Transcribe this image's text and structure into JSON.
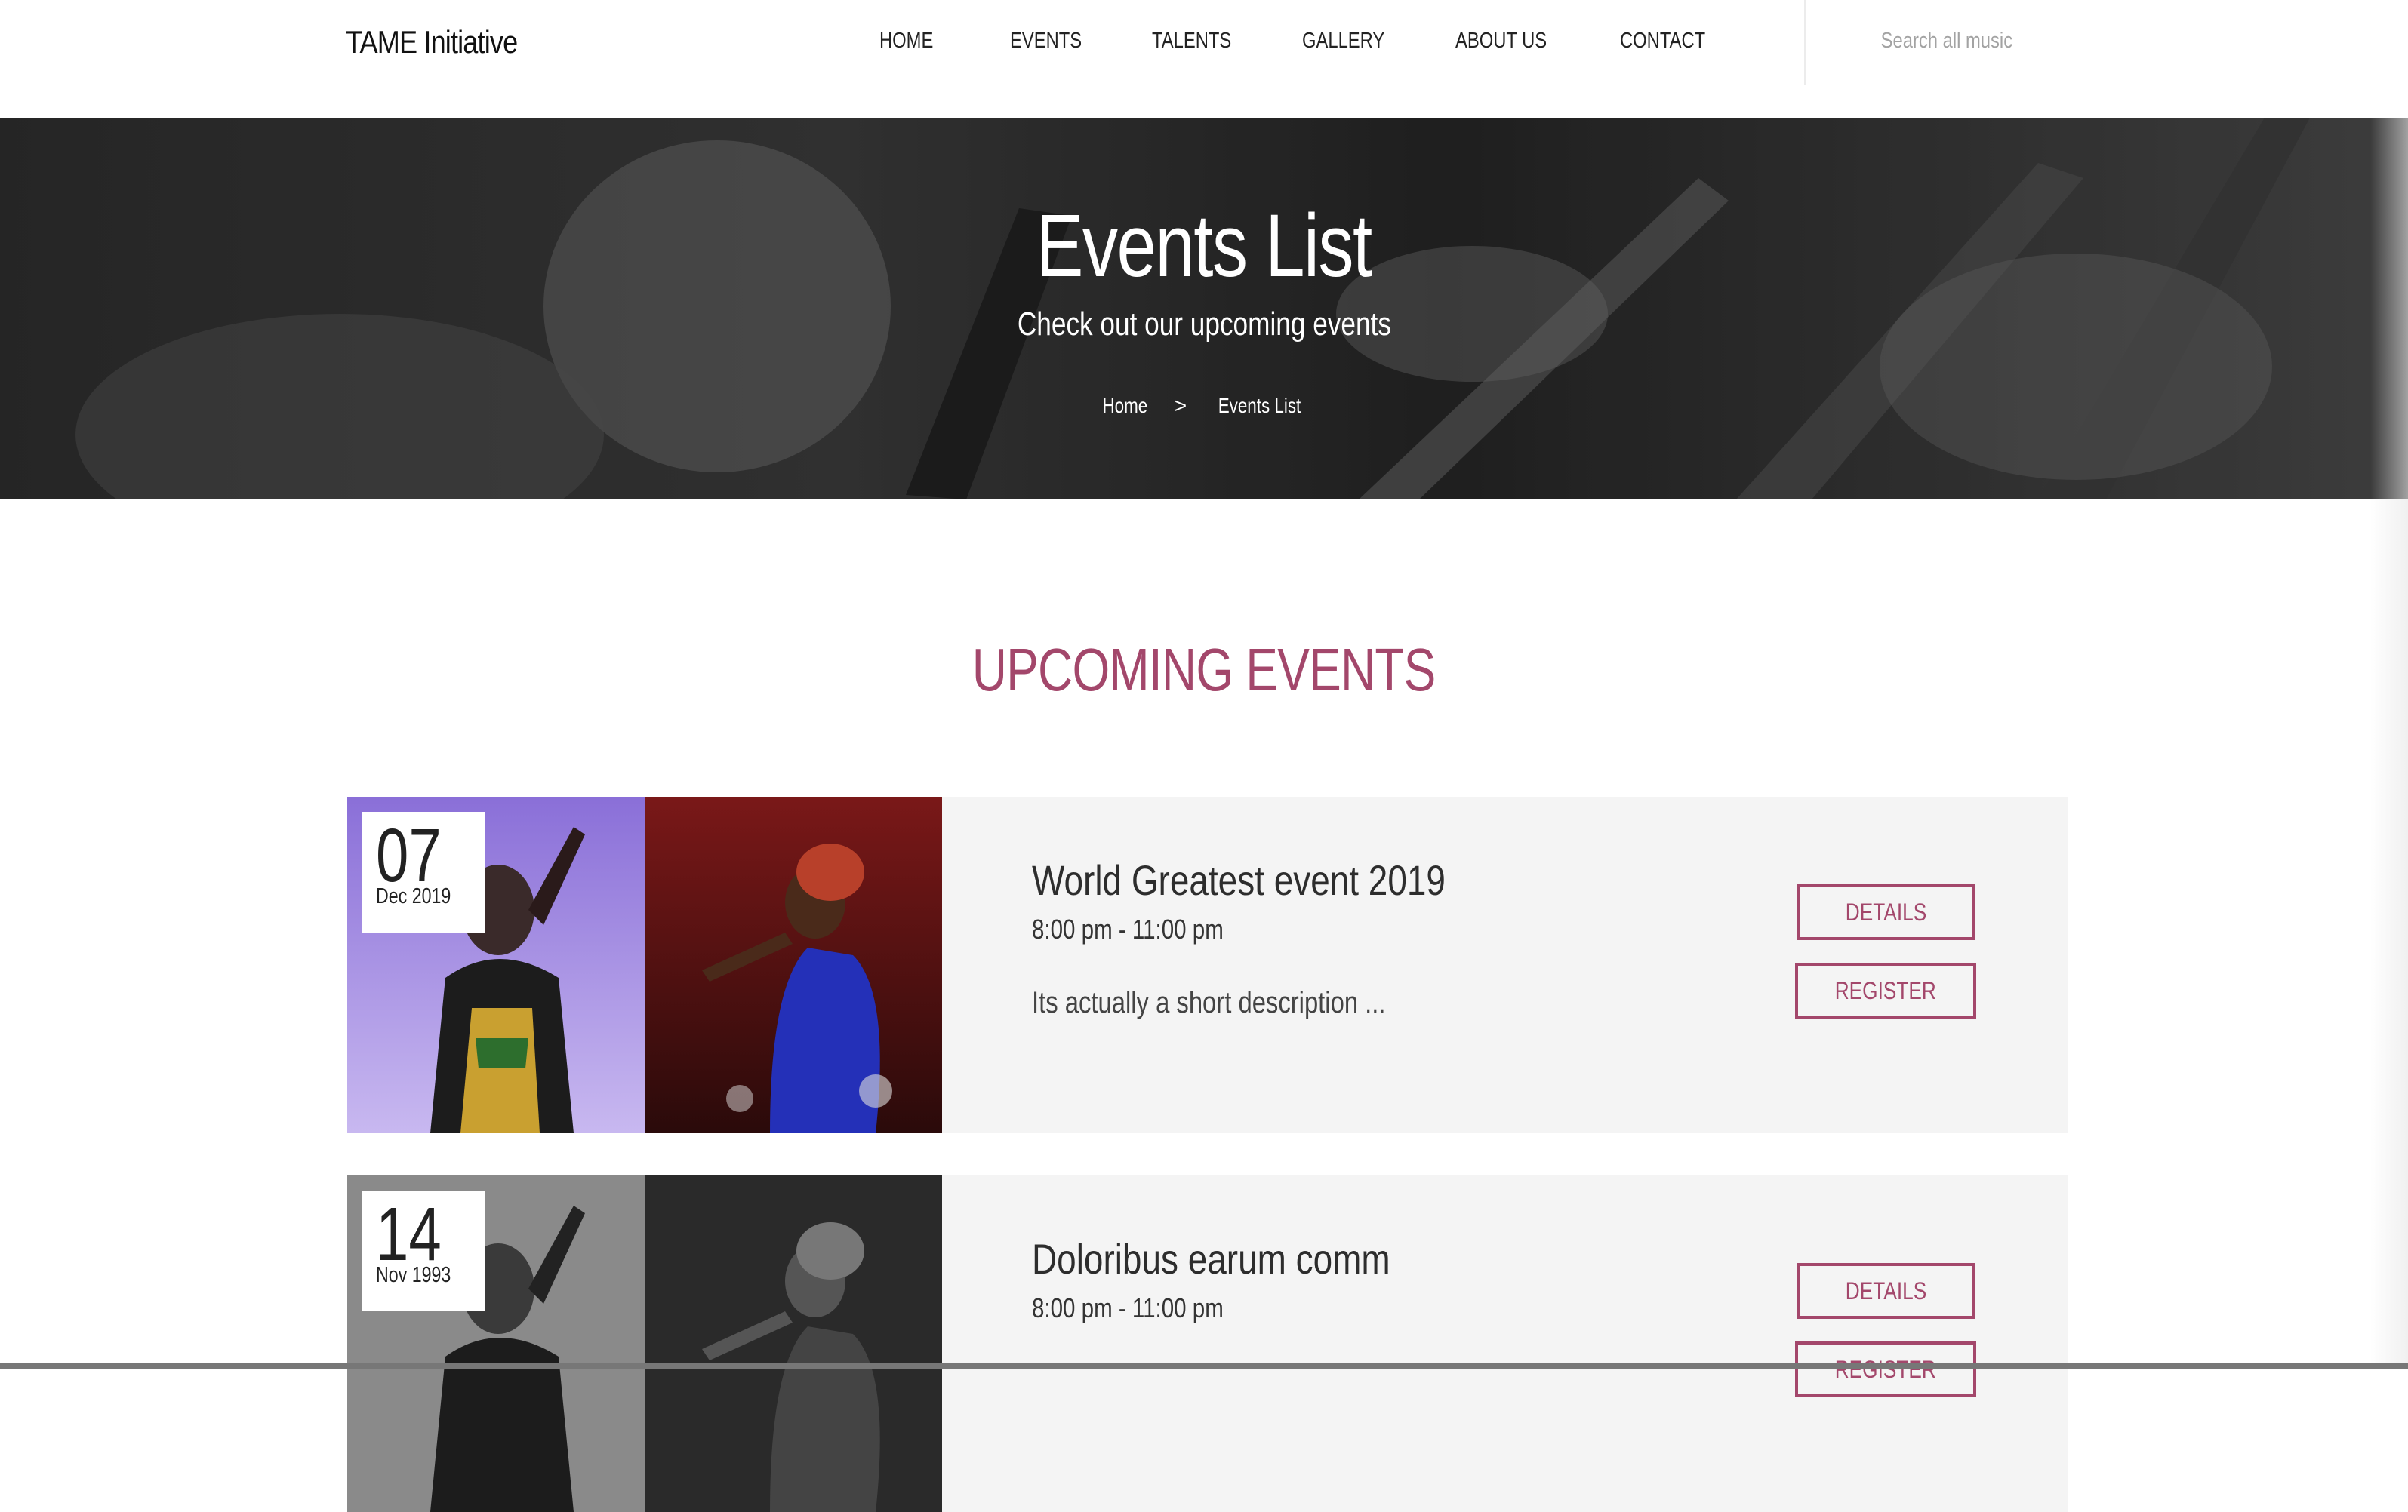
{
  "header": {
    "brand": "TAME Initiative",
    "nav": [
      "HOME",
      "EVENTS",
      "TALENTS",
      "GALLERY",
      "ABOUT US",
      "CONTACT"
    ],
    "search_placeholder": "Search all music"
  },
  "hero": {
    "title": "Events List",
    "subtitle": "Check out our upcoming events",
    "breadcrumb": {
      "home": "Home",
      "separator": ">",
      "current": "Events List"
    }
  },
  "section": {
    "title": "UPCOMING EVENTS"
  },
  "colors": {
    "accent": "#a3476b",
    "card_bg": "#f4f4f4",
    "hero_bg": "#3a3a3a"
  },
  "events": [
    {
      "day": "07",
      "month_year": "Dec 2019",
      "title": "World Greatest event 2019",
      "time": "8:00 pm - 11:00 pm",
      "description": "Its actually a short description ...",
      "details_label": "DETAILS",
      "register_label": "REGISTER"
    },
    {
      "day": "14",
      "month_year": "Nov 1993",
      "title": "Doloribus earum comm",
      "time": "8:00 pm - 11:00 pm",
      "description": "",
      "details_label": "DETAILS",
      "register_label": "REGISTER"
    }
  ]
}
